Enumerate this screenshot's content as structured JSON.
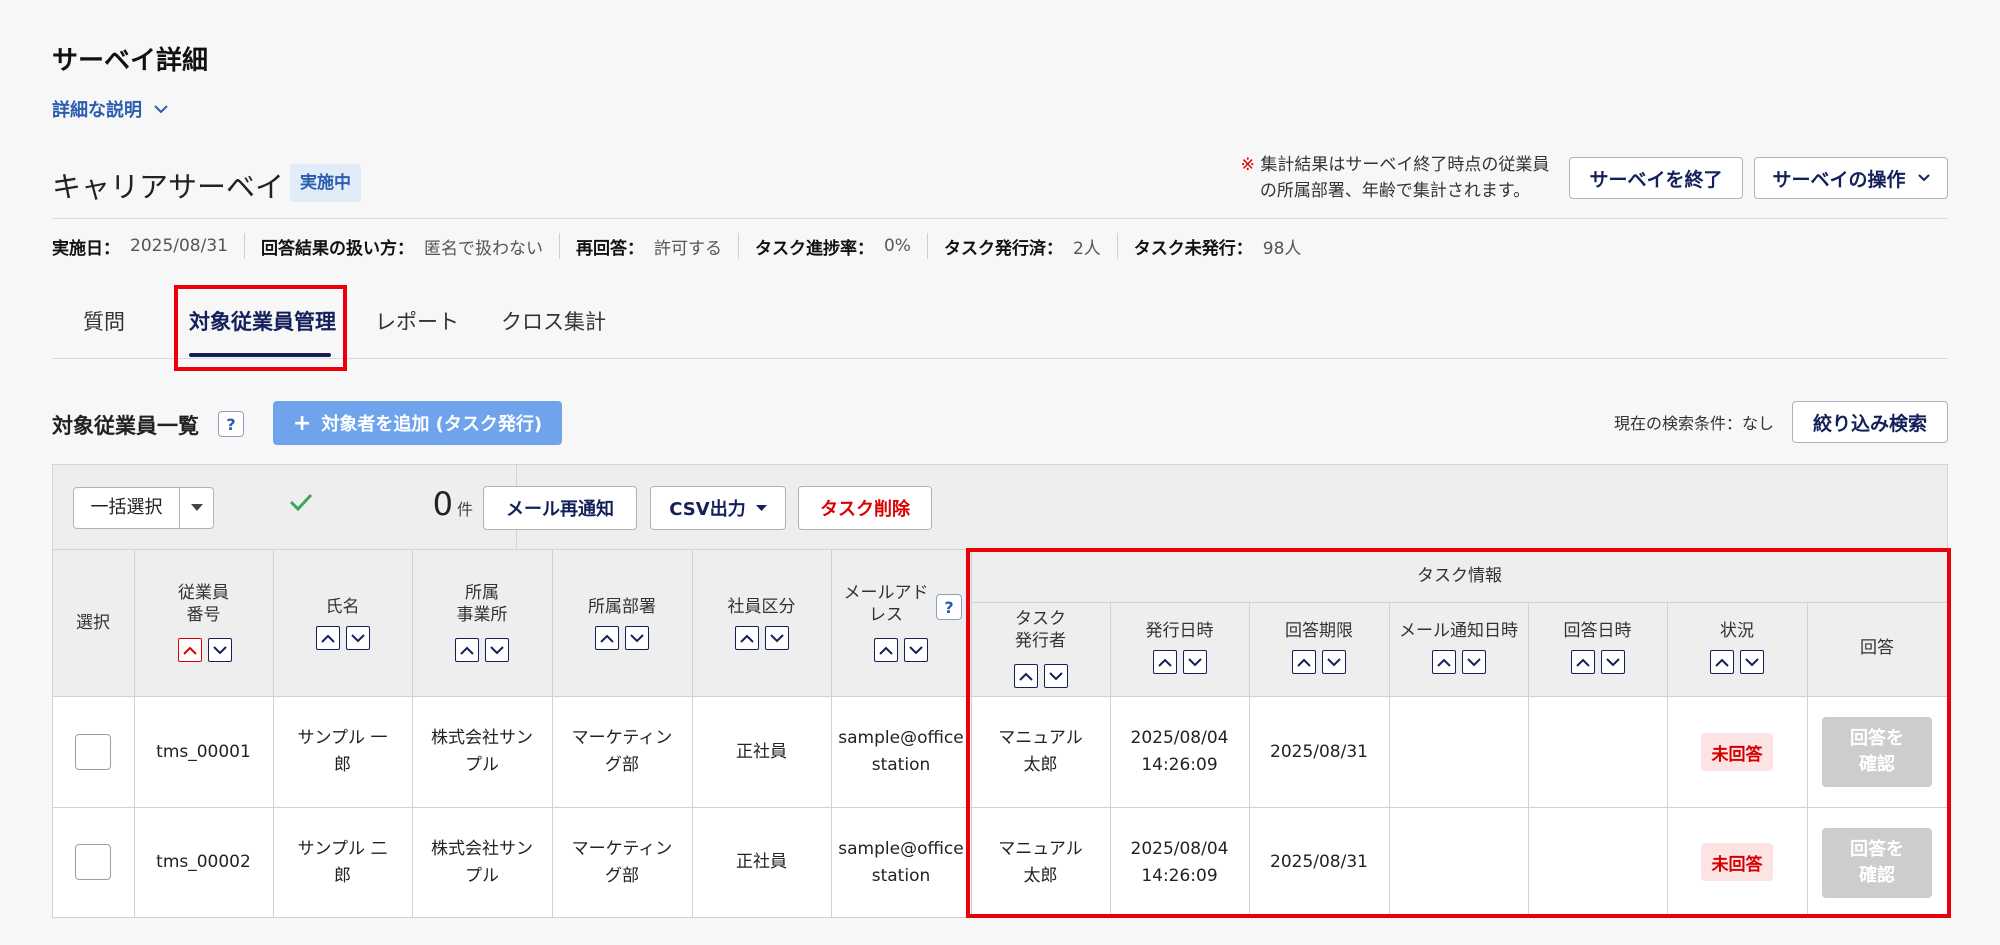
{
  "page": {
    "title": "サーベイ詳細",
    "detail_link": "詳細な説明"
  },
  "survey": {
    "name": "キャリアサーベイ",
    "status": "実施中",
    "note_mark": "※",
    "note_line1": " 集計結果はサーベイ終了時点の従業員",
    "note_line2": "の所属部署、年齢で集計されます。",
    "end_button": "サーベイを終了",
    "ops_button": "サーベイの操作"
  },
  "meta": [
    {
      "label": "実施日：",
      "value": "2025/08/31"
    },
    {
      "label": "回答結果の扱い方：",
      "value": "匿名で扱わない"
    },
    {
      "label": "再回答：",
      "value": "許可する"
    },
    {
      "label": "タスク進捗率：",
      "value": "0%"
    },
    {
      "label": "タスク発行済：",
      "value": "2人"
    },
    {
      "label": "タスク未発行：",
      "value": "98人"
    }
  ],
  "tabs": [
    "質問",
    "対象従業員管理",
    "レポート",
    "クロス集計"
  ],
  "active_tab": "対象従業員管理",
  "section": {
    "title": "対象従業員一覧",
    "help": "?",
    "add_button": "対象者を追加 (タスク発行)",
    "search_condition": "現在の検索条件：なし",
    "filter_button": "絞り込み検索"
  },
  "toolbar": {
    "bulk_select": "一括選択",
    "count": "0",
    "count_unit": "件",
    "resend_mail": "メール再通知",
    "csv_export": "CSV出力",
    "delete_task": "タスク削除"
  },
  "table": {
    "group_header": "タスク情報",
    "columns": [
      {
        "line1": "選択",
        "line2": ""
      },
      {
        "line1": "従業員",
        "line2": "番号"
      },
      {
        "line1": "氏名",
        "line2": ""
      },
      {
        "line1": "所属",
        "line2": "事業所"
      },
      {
        "line1": "所属部署",
        "line2": ""
      },
      {
        "line1": "社員区分",
        "line2": ""
      },
      {
        "line1": "メールアド",
        "line2": "レス"
      },
      {
        "line1": "タスク",
        "line2": "発行者"
      },
      {
        "line1": "発行日時",
        "line2": ""
      },
      {
        "line1": "回答期限",
        "line2": ""
      },
      {
        "line1": "メール通知日時",
        "line2": ""
      },
      {
        "line1": "回答日時",
        "line2": ""
      },
      {
        "line1": "状況",
        "line2": ""
      },
      {
        "line1": "回答",
        "line2": ""
      }
    ],
    "rows": [
      {
        "employee_no": "tms_00001",
        "name1": "サンプル 一",
        "name2": "郎",
        "office1": "株式会社サン",
        "office2": "プル",
        "dept1": "マーケティン",
        "dept2": "グ部",
        "type": "正社員",
        "email1": "sample@office",
        "email2": "station",
        "issuer1": "マニュアル",
        "issuer2": "太郎",
        "issued_date": "2025/08/04",
        "issued_time": "14:26:09",
        "deadline": "2025/08/31",
        "mail_notified": "",
        "answered_at": "",
        "status": "未回答",
        "confirm1": "回答を",
        "confirm2": "確認"
      },
      {
        "employee_no": "tms_00002",
        "name1": "サンプル 二",
        "name2": "郎",
        "office1": "株式会社サン",
        "office2": "プル",
        "dept1": "マーケティン",
        "dept2": "グ部",
        "type": "正社員",
        "email1": "sample@office",
        "email2": "station",
        "issuer1": "マニュアル",
        "issuer2": "太郎",
        "issued_date": "2025/08/04",
        "issued_time": "14:26:09",
        "deadline": "2025/08/31",
        "mail_notified": "",
        "answered_at": "",
        "status": "未回答",
        "confirm1": "回答を",
        "confirm2": "確認"
      }
    ]
  },
  "colors": {
    "primary": "#14205a",
    "link": "#2a5db0",
    "highlight_border": "#e8000b",
    "status_red": "#d40000",
    "add_button": "#6fa3ec"
  }
}
